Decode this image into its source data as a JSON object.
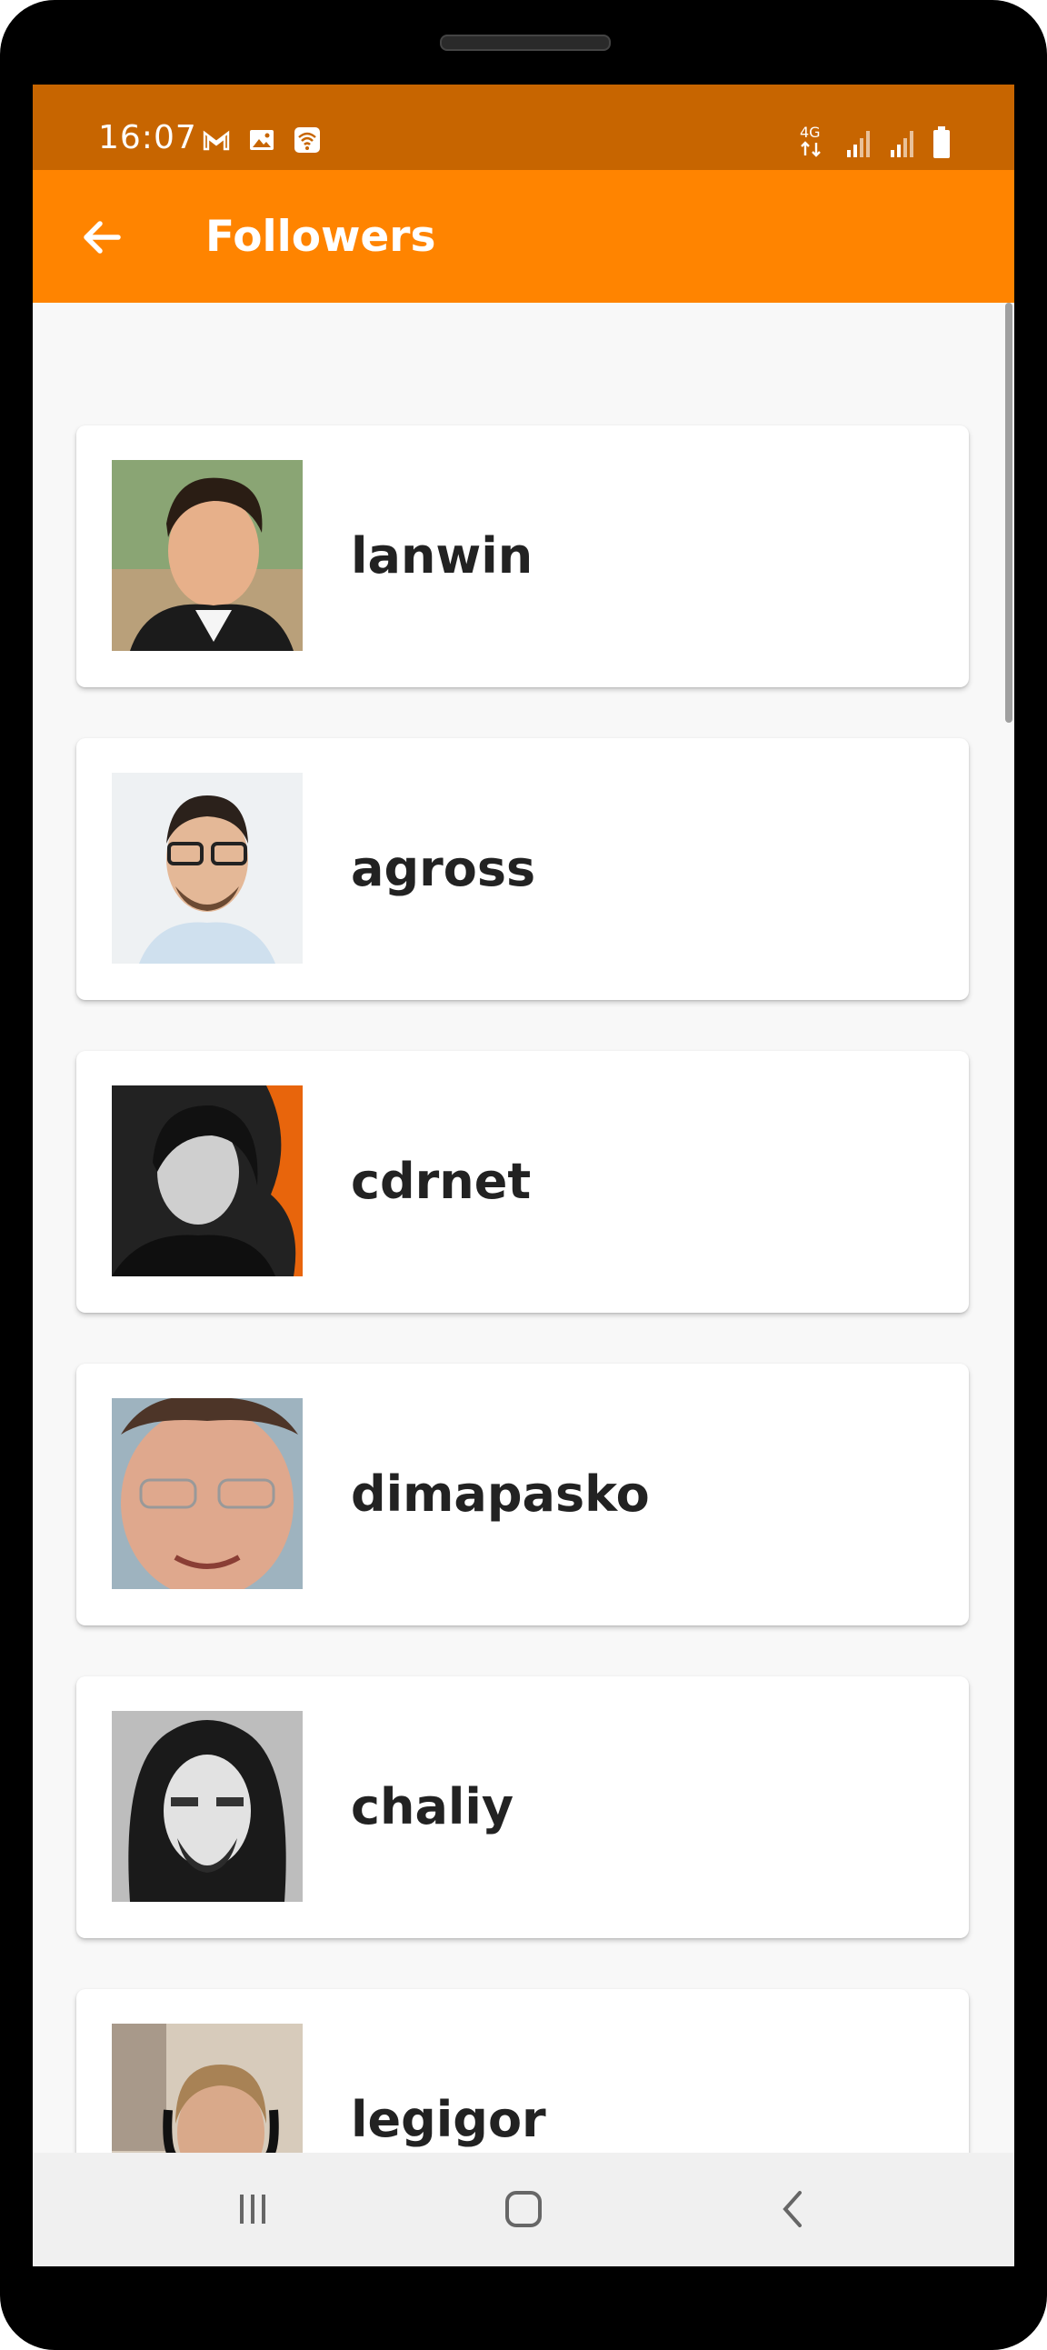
{
  "status_bar": {
    "time": "16:07",
    "left_icons": [
      "gmail-icon",
      "image-icon",
      "wifi-call-icon"
    ],
    "right_icons": [
      "network-4g-icon",
      "signal-icon",
      "signal-icon",
      "battery-icon"
    ],
    "network_label": "4G"
  },
  "app_bar": {
    "title": "Followers",
    "back_icon": "arrow-left-icon",
    "color": "#ff8400",
    "status_color": "#c76500"
  },
  "followers": [
    {
      "username": "lanwin",
      "avatar_bg": "#6f8b5a"
    },
    {
      "username": "agross",
      "avatar_bg": "#eef1f3"
    },
    {
      "username": "cdrnet",
      "avatar_bg": "#1c1c1c"
    },
    {
      "username": "dimapasko",
      "avatar_bg": "#c79a82"
    },
    {
      "username": "chaliy",
      "avatar_bg": "#9a9a9a"
    },
    {
      "username": "legigor",
      "avatar_bg": "#b9a48d"
    }
  ],
  "nav_bar": {
    "recents_icon": "recents-icon",
    "home_icon": "home-icon",
    "back_icon": "back-chevron-icon"
  }
}
